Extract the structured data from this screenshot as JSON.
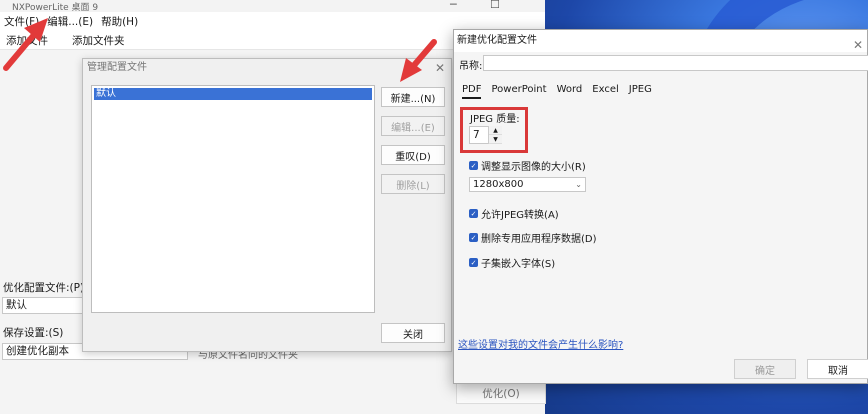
{
  "app": {
    "title": "NXPowerLite 桌面 9",
    "menus": [
      "文件(F)",
      "编辑...(E)",
      "帮助(H)"
    ],
    "toolbar": [
      "添加文件",
      "添加文件夹"
    ],
    "profile_label": "优化配置文件:(P)",
    "profile_value": "默认",
    "save_label": "保存设置:(S)",
    "save_value": "创建优化副本",
    "save_hint": "与原文件名同的文件夹",
    "optimize_button": "优化(O)"
  },
  "manage_dialog": {
    "title": "管理配置文件",
    "list_items": [
      "默认"
    ],
    "buttons": {
      "new": "新建...(N)",
      "edit": "编辑...(E)",
      "reset": "重叹(D)",
      "delete": "删除(L)",
      "close": "关闭"
    }
  },
  "new_dialog": {
    "title": "新建优化配置文件",
    "name_label": "吊称:",
    "tabs": [
      "PDF",
      "PowerPoint",
      "Word",
      "Excel",
      "JPEG"
    ],
    "active_tab": "PDF",
    "jpeg_quality_label": "JPEG 质量:",
    "jpeg_quality_value": "7",
    "resize_label": "调整显示图像的大小(R)",
    "resize_value": "1280x800",
    "allow_jpeg": "允许JPEG转换(A)",
    "remove_app_data": "删除专用应用程序数据(D)",
    "subset_fonts": "子集嵌入字体(S)",
    "help_link": "这些设置对我的文件会产生什么影响?",
    "ok": "确定",
    "cancel": "取消"
  },
  "colors": {
    "accent": "#2b5fc4",
    "highlight": "#d93838"
  }
}
